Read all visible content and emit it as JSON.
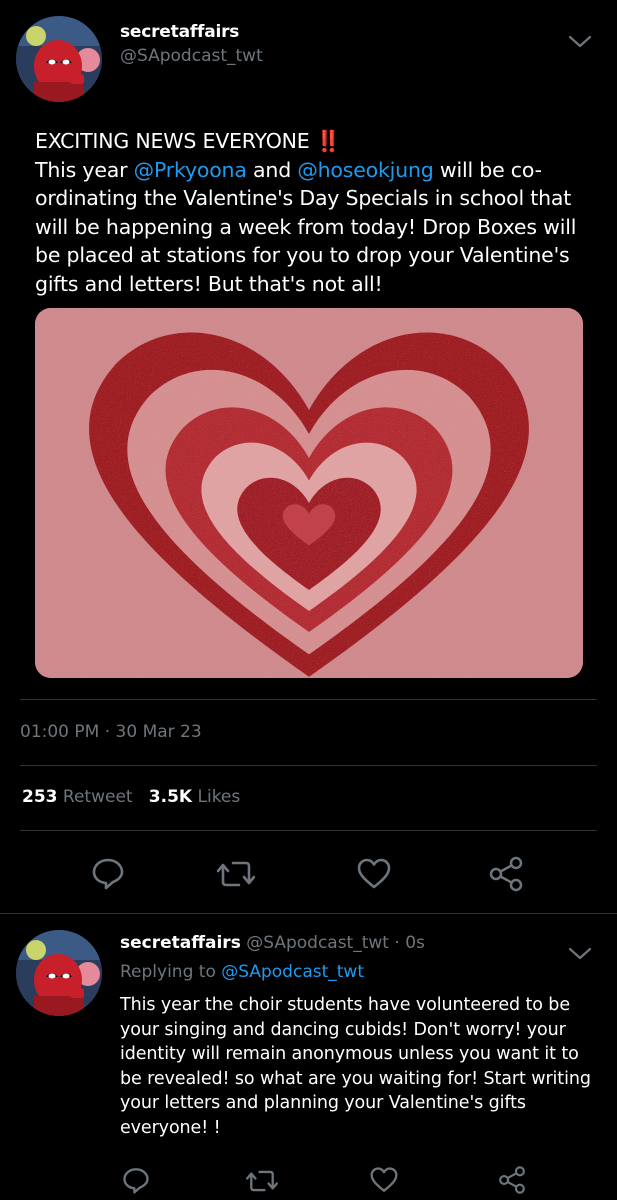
{
  "colors": {
    "background": "#000000",
    "text": "#ffffff",
    "muted": "#6e767d",
    "link": "#1d9bf0",
    "emoji_red": "#e0245e",
    "heart_dark": "#9e1b20",
    "heart_light": "#dc9a9a"
  },
  "tweet": {
    "display_name": "secretaffairs",
    "handle": "@SApodcast_twt",
    "text_line1": "EXCITING NEWS EVERYONE",
    "emoji": "‼️",
    "text_p2_a": "This year ",
    "mention1": "@Prkyoona",
    "text_p2_b": " and ",
    "mention2": "@hoseokjung",
    "text_p2_c": " will be co-ordinating the Valentine's Day Specials in school that will be happening a week from today!  Drop Boxes will be placed at stations for you to drop your Valentine's gifts and letters!  But that's not all!",
    "image_icon": "nested-hearts-image",
    "time": "01:00 PM",
    "dot": "·",
    "date": "30 Mar 23",
    "retweet_count": "253",
    "retweet_label": "Retweet",
    "like_count": "3.5K",
    "like_label": "Likes"
  },
  "actions": [
    "reply-icon",
    "retweet-icon",
    "like-icon",
    "share-icon"
  ],
  "reply": {
    "display_name": "secretaffairs",
    "handle": "@SApodcast_twt",
    "dot": "·",
    "time": "0s",
    "replying_to_label": "Replying to",
    "replying_to_handle": "@SApodcast_twt",
    "text": "This year the choir students have volunteered to be your singing and dancing cubids!  Don't worry!  your identity will remain anonymous unless you want it to be revealed!  so what are you waiting for!  Start writing your letters and planning your Valentine's gifts everyone! !"
  }
}
